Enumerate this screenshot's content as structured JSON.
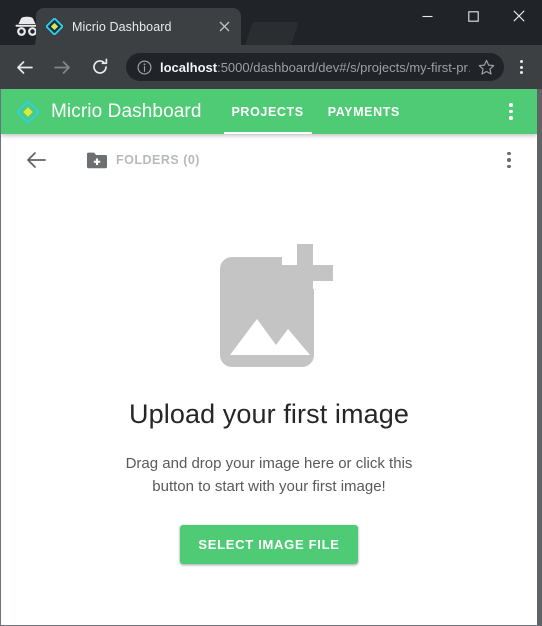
{
  "browser": {
    "incognito_icon": "incognito-icon",
    "tab": {
      "title": "Micrio Dashboard",
      "favicon": "micrio-diamond-favicon",
      "close_icon": "close-icon"
    },
    "window_controls": {
      "minimize": "minimize-icon",
      "maximize": "maximize-icon",
      "close": "close-icon"
    },
    "toolbar": {
      "back_icon": "back-arrow-icon",
      "forward_icon": "forward-arrow-icon",
      "reload_icon": "reload-icon",
      "info_icon": "page-info-icon",
      "url_host": "localhost",
      "url_rest": ":5000/dashboard/dev#/s/projects/my-first-pr…",
      "bookmark_icon": "star-icon",
      "menu_icon": "three-dot-menu-icon"
    }
  },
  "app": {
    "logo_icon": "micrio-diamond-logo",
    "title": "Micrio Dashboard",
    "nav_tabs": [
      {
        "label": "PROJECTS",
        "active": true
      },
      {
        "label": "PAYMENTS",
        "active": false
      }
    ],
    "overflow_menu_icon": "three-dot-menu-icon",
    "accent_color": "#4ecb74",
    "header_text_color": "#ffffff"
  },
  "folders_bar": {
    "back_icon": "back-arrow-icon",
    "folder_add_icon": "folder-add-icon",
    "label": "FOLDERS (0)",
    "overflow_menu_icon": "three-dot-menu-icon",
    "label_color": "#b7babd"
  },
  "empty_state": {
    "placeholder_icon": "add-photo-icon",
    "placeholder_color": "#c4c4c4",
    "title": "Upload your first image",
    "description": "Drag and drop your image here or click this button to start with your first image!",
    "button_label": "SELECT IMAGE FILE",
    "button_color": "#4ecb74"
  }
}
